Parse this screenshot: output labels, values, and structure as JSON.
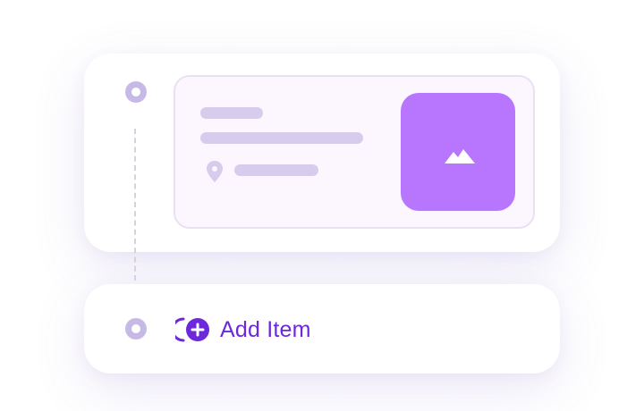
{
  "timeline": {
    "items": [
      {
        "marker_icon": "timeline-dot-icon",
        "location_icon": "map-pin-icon",
        "thumbnail_icon": "mountain-image-icon"
      }
    ],
    "add_item": {
      "icon": "add-circle-icon",
      "label": "Add Item"
    }
  },
  "colors": {
    "accent": "#6d28d9",
    "thumbnail": "#b776fd",
    "skeleton": "#d8ccec",
    "marker": "#c7b9e6",
    "item_background": "#fcf6ff",
    "item_border": "#e9e1f2"
  }
}
